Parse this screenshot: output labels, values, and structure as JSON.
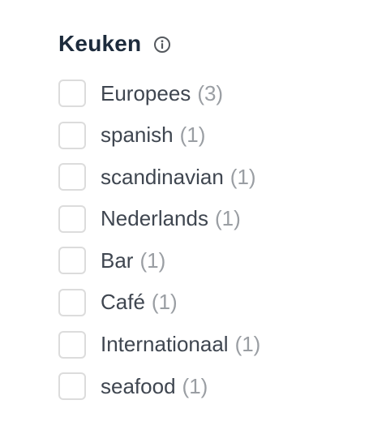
{
  "filter": {
    "title": "Keuken",
    "info_icon": "info-icon",
    "options": [
      {
        "label": "Europees",
        "count": "(3)",
        "checked": false
      },
      {
        "label": "spanish",
        "count": "(1)",
        "checked": false
      },
      {
        "label": "scandinavian",
        "count": "(1)",
        "checked": false
      },
      {
        "label": "Nederlands",
        "count": "(1)",
        "checked": false
      },
      {
        "label": "Bar",
        "count": "(1)",
        "checked": false
      },
      {
        "label": "Café",
        "count": "(1)",
        "checked": false
      },
      {
        "label": "Internationaal",
        "count": "(1)",
        "checked": false
      },
      {
        "label": "seafood",
        "count": "(1)",
        "checked": false
      }
    ]
  },
  "colors": {
    "title": "#1d2b3c",
    "label": "#3f4650",
    "count": "#9a9ea3",
    "checkbox_border": "#dcdcdc",
    "icon": "#55595e"
  }
}
